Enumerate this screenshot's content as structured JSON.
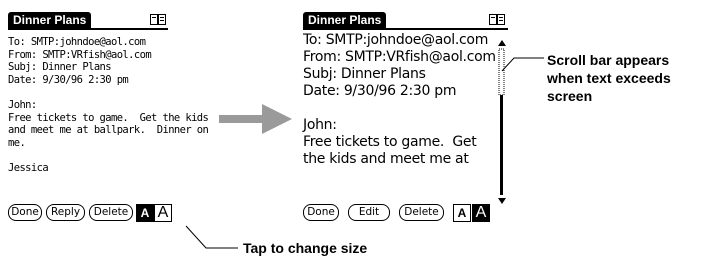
{
  "left_screen": {
    "title": "Dinner Plans",
    "body": "To: SMTP:johndoe@aol.com\nFrom: SMTP:VRfish@aol.com\nSubj: Dinner Plans\nDate: 9/30/96 2:30 pm\n\nJohn:\nFree tickets to game.  Get the kids\nand meet me at ballpark.  Dinner on\nme.\n\nJessica",
    "buttons": [
      "Done",
      "Reply",
      "Delete"
    ],
    "font_small_label": "A",
    "font_large_label": "A"
  },
  "right_screen": {
    "title": "Dinner Plans",
    "body": "To: SMTP:johndoe@aol.com\nFrom: SMTP:VRfish@aol.com\nSubj: Dinner Plans\nDate: 9/30/96 2:30 pm\n\nJohn:\nFree tickets to game.  Get\nthe kids and meet me at",
    "buttons": [
      "Done",
      "Edit",
      "Delete"
    ],
    "font_small_label": "A",
    "font_large_label": "A"
  },
  "callouts": {
    "scroll": "Scroll bar appears\nwhen text exceeds\nscreen",
    "tap": "Tap to change size"
  },
  "colors": {
    "arrow": "#9a9a9a",
    "ink": "#000000"
  }
}
